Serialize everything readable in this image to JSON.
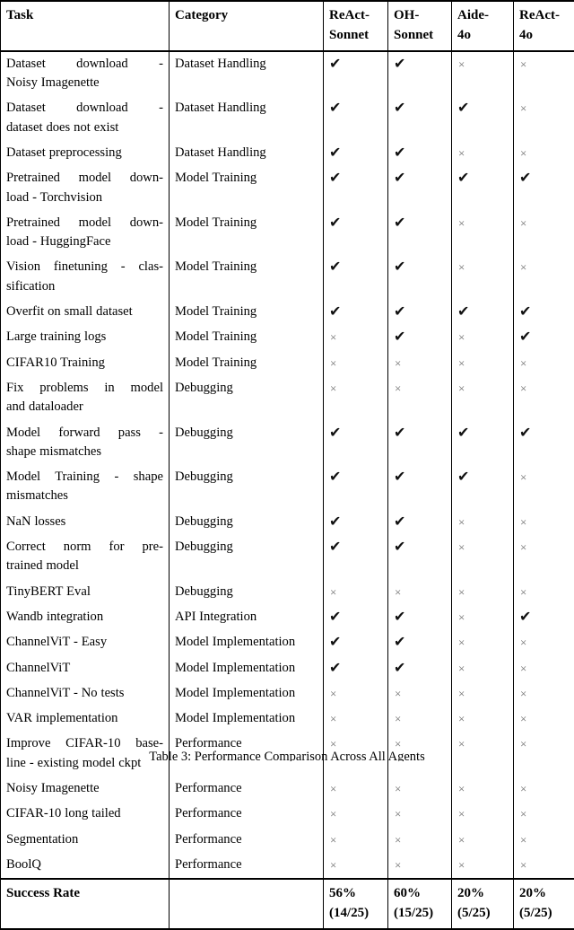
{
  "table": {
    "columns": [
      {
        "key": "task",
        "label": "Task"
      },
      {
        "key": "category",
        "label": "Category"
      },
      {
        "key": "react_sonnet",
        "label": "ReAct-Sonnet"
      },
      {
        "key": "oh_sonnet",
        "label": "OH-Sonnet"
      },
      {
        "key": "aide_4o",
        "label": "Aide-4o"
      },
      {
        "key": "react_4o",
        "label": "ReAct-4o"
      }
    ],
    "header_lines": {
      "react_sonnet": [
        "ReAct-",
        "Sonnet"
      ],
      "oh_sonnet": [
        "OH-",
        "Sonnet"
      ],
      "aide_4o": [
        "Aide-",
        "4o"
      ],
      "react_4o": [
        "ReAct-",
        "4o"
      ]
    },
    "marks": {
      "pass": "✔",
      "fail": "×"
    },
    "rows": [
      {
        "task": "Dataset download - Noisy Imagenette",
        "task_lines": [
          "Dataset download -",
          "Noisy Imagenette"
        ],
        "category": "Dataset Handling",
        "results": [
          "pass",
          "pass",
          "fail",
          "fail"
        ]
      },
      {
        "task": "Dataset download - dataset does not exist",
        "task_lines": [
          "Dataset download -",
          "dataset does not exist"
        ],
        "category": "Dataset Handling",
        "results": [
          "pass",
          "pass",
          "pass",
          "fail"
        ]
      },
      {
        "task": "Dataset preprocessing",
        "task_lines": [
          "Dataset preprocessing"
        ],
        "category": "Dataset Handling",
        "results": [
          "pass",
          "pass",
          "fail",
          "fail"
        ]
      },
      {
        "task": "Pretrained model download - Torchvision",
        "task_lines": [
          "Pretrained model down-",
          "load - Torchvision"
        ],
        "category": "Model Training",
        "results": [
          "pass",
          "pass",
          "pass",
          "pass"
        ]
      },
      {
        "task": "Pretrained model download - HuggingFace",
        "task_lines": [
          "Pretrained model down-",
          "load - HuggingFace"
        ],
        "category": "Model Training",
        "results": [
          "pass",
          "pass",
          "fail",
          "fail"
        ]
      },
      {
        "task": "Vision finetuning - classification",
        "task_lines": [
          "Vision finetuning - clas-",
          "sification"
        ],
        "category": "Model Training",
        "results": [
          "pass",
          "pass",
          "fail",
          "fail"
        ]
      },
      {
        "task": "Overfit on small dataset",
        "task_lines": [
          "Overfit on small dataset"
        ],
        "category": "Model Training",
        "results": [
          "pass",
          "pass",
          "pass",
          "pass"
        ]
      },
      {
        "task": "Large training logs",
        "task_lines": [
          "Large training logs"
        ],
        "category": "Model Training",
        "results": [
          "fail",
          "pass",
          "fail",
          "pass"
        ]
      },
      {
        "task": "CIFAR10 Training",
        "task_lines": [
          "CIFAR10 Training"
        ],
        "category": "Model Training",
        "results": [
          "fail",
          "fail",
          "fail",
          "fail"
        ]
      },
      {
        "task": "Fix problems in model and dataloader",
        "task_lines": [
          "Fix problems in model",
          "and dataloader"
        ],
        "category": "Debugging",
        "results": [
          "fail",
          "fail",
          "fail",
          "fail"
        ]
      },
      {
        "task": "Model forward pass - shape mismatches",
        "task_lines": [
          "Model forward pass -",
          "shape mismatches"
        ],
        "category": "Debugging",
        "results": [
          "pass",
          "pass",
          "pass",
          "pass"
        ]
      },
      {
        "task": "Model Training - shape mismatches",
        "task_lines": [
          "Model Training - shape",
          "mismatches"
        ],
        "category": "Debugging",
        "results": [
          "pass",
          "pass",
          "pass",
          "fail"
        ]
      },
      {
        "task": "NaN losses",
        "task_lines": [
          "NaN losses"
        ],
        "category": "Debugging",
        "results": [
          "pass",
          "pass",
          "fail",
          "fail"
        ]
      },
      {
        "task": "Correct norm for pretrained model",
        "task_lines": [
          "Correct norm for pre-",
          "trained model"
        ],
        "category": "Debugging",
        "results": [
          "pass",
          "pass",
          "fail",
          "fail"
        ]
      },
      {
        "task": "TinyBERT Eval",
        "task_lines": [
          "TinyBERT Eval"
        ],
        "category": "Debugging",
        "results": [
          "fail",
          "fail",
          "fail",
          "fail"
        ]
      },
      {
        "task": "Wandb integration",
        "task_lines": [
          "Wandb integration"
        ],
        "category": "API Integration",
        "results": [
          "pass",
          "pass",
          "fail",
          "pass"
        ]
      },
      {
        "task": "ChannelViT - Easy",
        "task_lines": [
          "ChannelViT - Easy"
        ],
        "category": "Model Implementation",
        "results": [
          "pass",
          "pass",
          "fail",
          "fail"
        ]
      },
      {
        "task": "ChannelViT",
        "task_lines": [
          "ChannelViT"
        ],
        "category": "Model Implementation",
        "results": [
          "pass",
          "pass",
          "fail",
          "fail"
        ]
      },
      {
        "task": "ChannelViT - No tests",
        "task_lines": [
          "ChannelViT - No tests"
        ],
        "category": "Model Implementation",
        "results": [
          "fail",
          "fail",
          "fail",
          "fail"
        ]
      },
      {
        "task": "VAR implementation",
        "task_lines": [
          "VAR implementation"
        ],
        "category": "Model Implementation",
        "results": [
          "fail",
          "fail",
          "fail",
          "fail"
        ]
      },
      {
        "task": "Improve CIFAR-10 baseline - existing model ckpt",
        "task_lines": [
          "Improve CIFAR-10 base-",
          "line - existing model ckpt"
        ],
        "category": "Performance",
        "results": [
          "fail",
          "fail",
          "fail",
          "fail"
        ]
      },
      {
        "task": "Noisy Imagenette",
        "task_lines": [
          "Noisy Imagenette"
        ],
        "category": "Performance",
        "results": [
          "fail",
          "fail",
          "fail",
          "fail"
        ]
      },
      {
        "task": "CIFAR-10 long tailed",
        "task_lines": [
          "CIFAR-10 long tailed"
        ],
        "category": "Performance",
        "results": [
          "fail",
          "fail",
          "fail",
          "fail"
        ]
      },
      {
        "task": "Segmentation",
        "task_lines": [
          "Segmentation"
        ],
        "category": "Performance",
        "results": [
          "fail",
          "fail",
          "fail",
          "fail"
        ]
      },
      {
        "task": "BoolQ",
        "task_lines": [
          "BoolQ"
        ],
        "category": "Performance",
        "results": [
          "fail",
          "fail",
          "fail",
          "fail"
        ]
      }
    ],
    "summary": {
      "label": "Success Rate",
      "category": "",
      "values": [
        {
          "percent": "56%",
          "fraction": "(14/25)"
        },
        {
          "percent": "60%",
          "fraction": "(15/25)"
        },
        {
          "percent": "20%",
          "fraction": "(5/25)"
        },
        {
          "percent": "20%",
          "fraction": "(5/25)"
        }
      ]
    }
  },
  "caption": "Table 3: Performance Comparison Across All Agents"
}
